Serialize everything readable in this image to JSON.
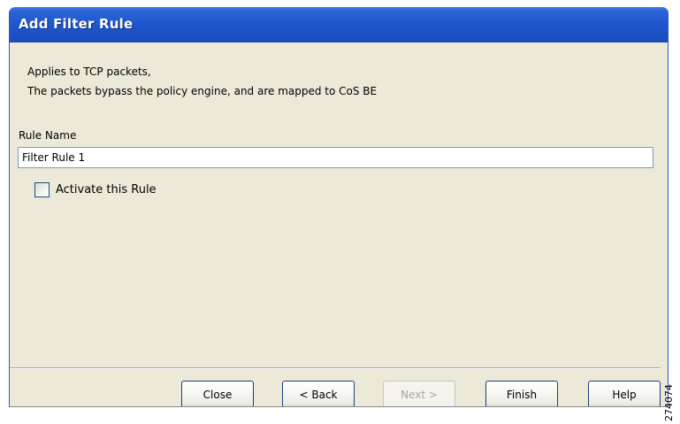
{
  "window": {
    "title": "Add Filter Rule"
  },
  "description": {
    "line1": "Applies to  TCP  packets,",
    "line2": "The packets bypass the policy engine, and are mapped to CoS  BE"
  },
  "form": {
    "rule_name_label": "Rule Name",
    "rule_name_value": "Filter Rule 1",
    "activate_label": "Activate this Rule",
    "activate_checked": false
  },
  "buttons": {
    "close": "Close",
    "back": "< Back",
    "next": "Next >",
    "finish": "Finish",
    "help": "Help"
  },
  "figure_id": "274074",
  "colors": {
    "titlebar": "#2a64d8",
    "dialog_bg": "#ece9d8",
    "disabled_text": "#aca899"
  }
}
